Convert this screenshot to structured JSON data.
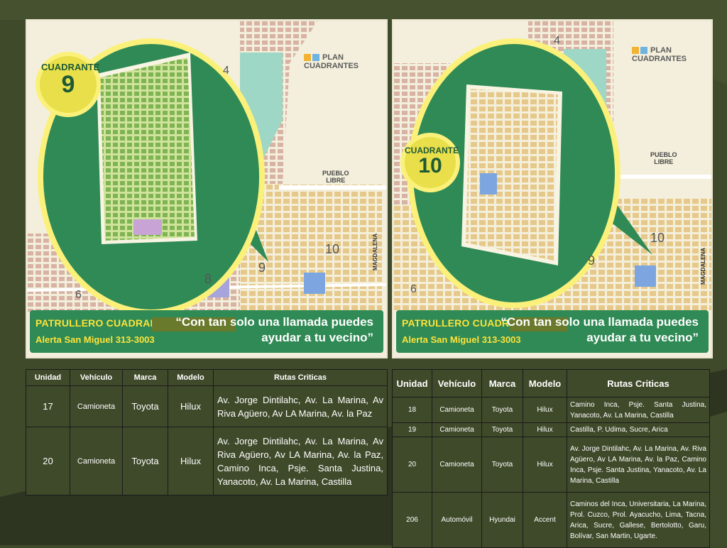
{
  "left_map": {
    "quadrant_label": "CUADRANTE",
    "quadrant_number": "9",
    "plan_logo": "PLAN CUADRANTES",
    "banner_title": "PATRULLERO CUADRANTE 9:",
    "banner_alert": "Alerta San Miguel 313-3003",
    "banner_quote_1": "“Con tan solo una llamada puedes",
    "banner_quote_2": "ayudar a tu vecino”",
    "place_pueblo": "PUEBLO",
    "place_libre": "LIBRE",
    "place_magdalena": "MAGDALENA",
    "num_4": "4",
    "num_6": "6",
    "num_8": "8",
    "num_9": "9",
    "num_10": "10"
  },
  "right_map": {
    "quadrant_label": "CUADRANTE",
    "quadrant_number": "10",
    "plan_logo": "PLAN CUADRANTES",
    "banner_title": "PATRULLERO CUADRANTE 10",
    "banner_alert": "Alerta San Miguel 313-3003",
    "banner_quote_1": "“Con tan solo una llamada puedes",
    "banner_quote_2": "ayudar a tu vecino”",
    "place_pueblo": "PUEBLO",
    "place_libre": "LIBRE",
    "place_magdalena": "MAGDALENA",
    "num_4": "4",
    "num_6": "6",
    "num_9": "9",
    "num_10": "10"
  },
  "left_table": {
    "headers": [
      "Unidad",
      "Vehículo",
      "Marca",
      "Modelo",
      "Rutas Criticas"
    ],
    "rows": [
      {
        "unidad": "17",
        "vehiculo": "Camioneta",
        "marca": "Toyota",
        "modelo": "Hilux",
        "rutas": "Av. Jorge Dintilahc, Av. La Marina, Av Riva Agüero, Av LA Marina, Av. la Paz"
      },
      {
        "unidad": "20",
        "vehiculo": "Camioneta",
        "marca": "Toyota",
        "modelo": "Hilux",
        "rutas": "Av. Jorge Dintilahc, Av. La Marina, Av Riva Agüero, Av LA Marina, Av. la Paz, Camino Inca, Psje. Santa Justina, Yanacoto, Av. La Marina, Castilla"
      }
    ]
  },
  "right_table": {
    "headers": [
      "Unidad",
      "Vehículo",
      "Marca",
      "Modelo",
      "Rutas Criticas"
    ],
    "rows": [
      {
        "unidad": "18",
        "vehiculo": "Camioneta",
        "marca": "Toyota",
        "modelo": "Hilux",
        "rutas": "Camino Inca, Psje. Santa Justina, Yanacoto, Av. La Marina, Castilla"
      },
      {
        "unidad": "19",
        "vehiculo": "Camioneta",
        "marca": "Toyota",
        "modelo": "Hilux",
        "rutas": "Castilla, P. Udima, Sucre, Arica"
      },
      {
        "unidad": "20",
        "vehiculo": "Camioneta",
        "marca": "Toyota",
        "modelo": "Hilux",
        "rutas": "Av. Jorge Dintilahc, Av. La Marina, Av. Riva Agüero, Av LA Marina, Av. la Paz, Camino Inca, Psje. Santa Justina, Yanacoto, Av. La Marina, Castilla"
      },
      {
        "unidad": "206",
        "vehiculo": "Automóvil",
        "marca": "Hyundai",
        "modelo": "Accent",
        "rutas": "Caminos del Inca, Universitaria, La Marina, Prol. Cuzco, Prol. Ayacucho, Lima, Tacna, Arica, Sucre, Gallese, Bertolotto, Garu, Bolívar, San Martin, Ugarte."
      }
    ]
  },
  "colors": {
    "background": "#3f4a2a",
    "banner": "#2f8a55",
    "banner_title": "#ffe23a",
    "map_green": "#2f8a55",
    "map_yellow": "#e8df4a"
  }
}
